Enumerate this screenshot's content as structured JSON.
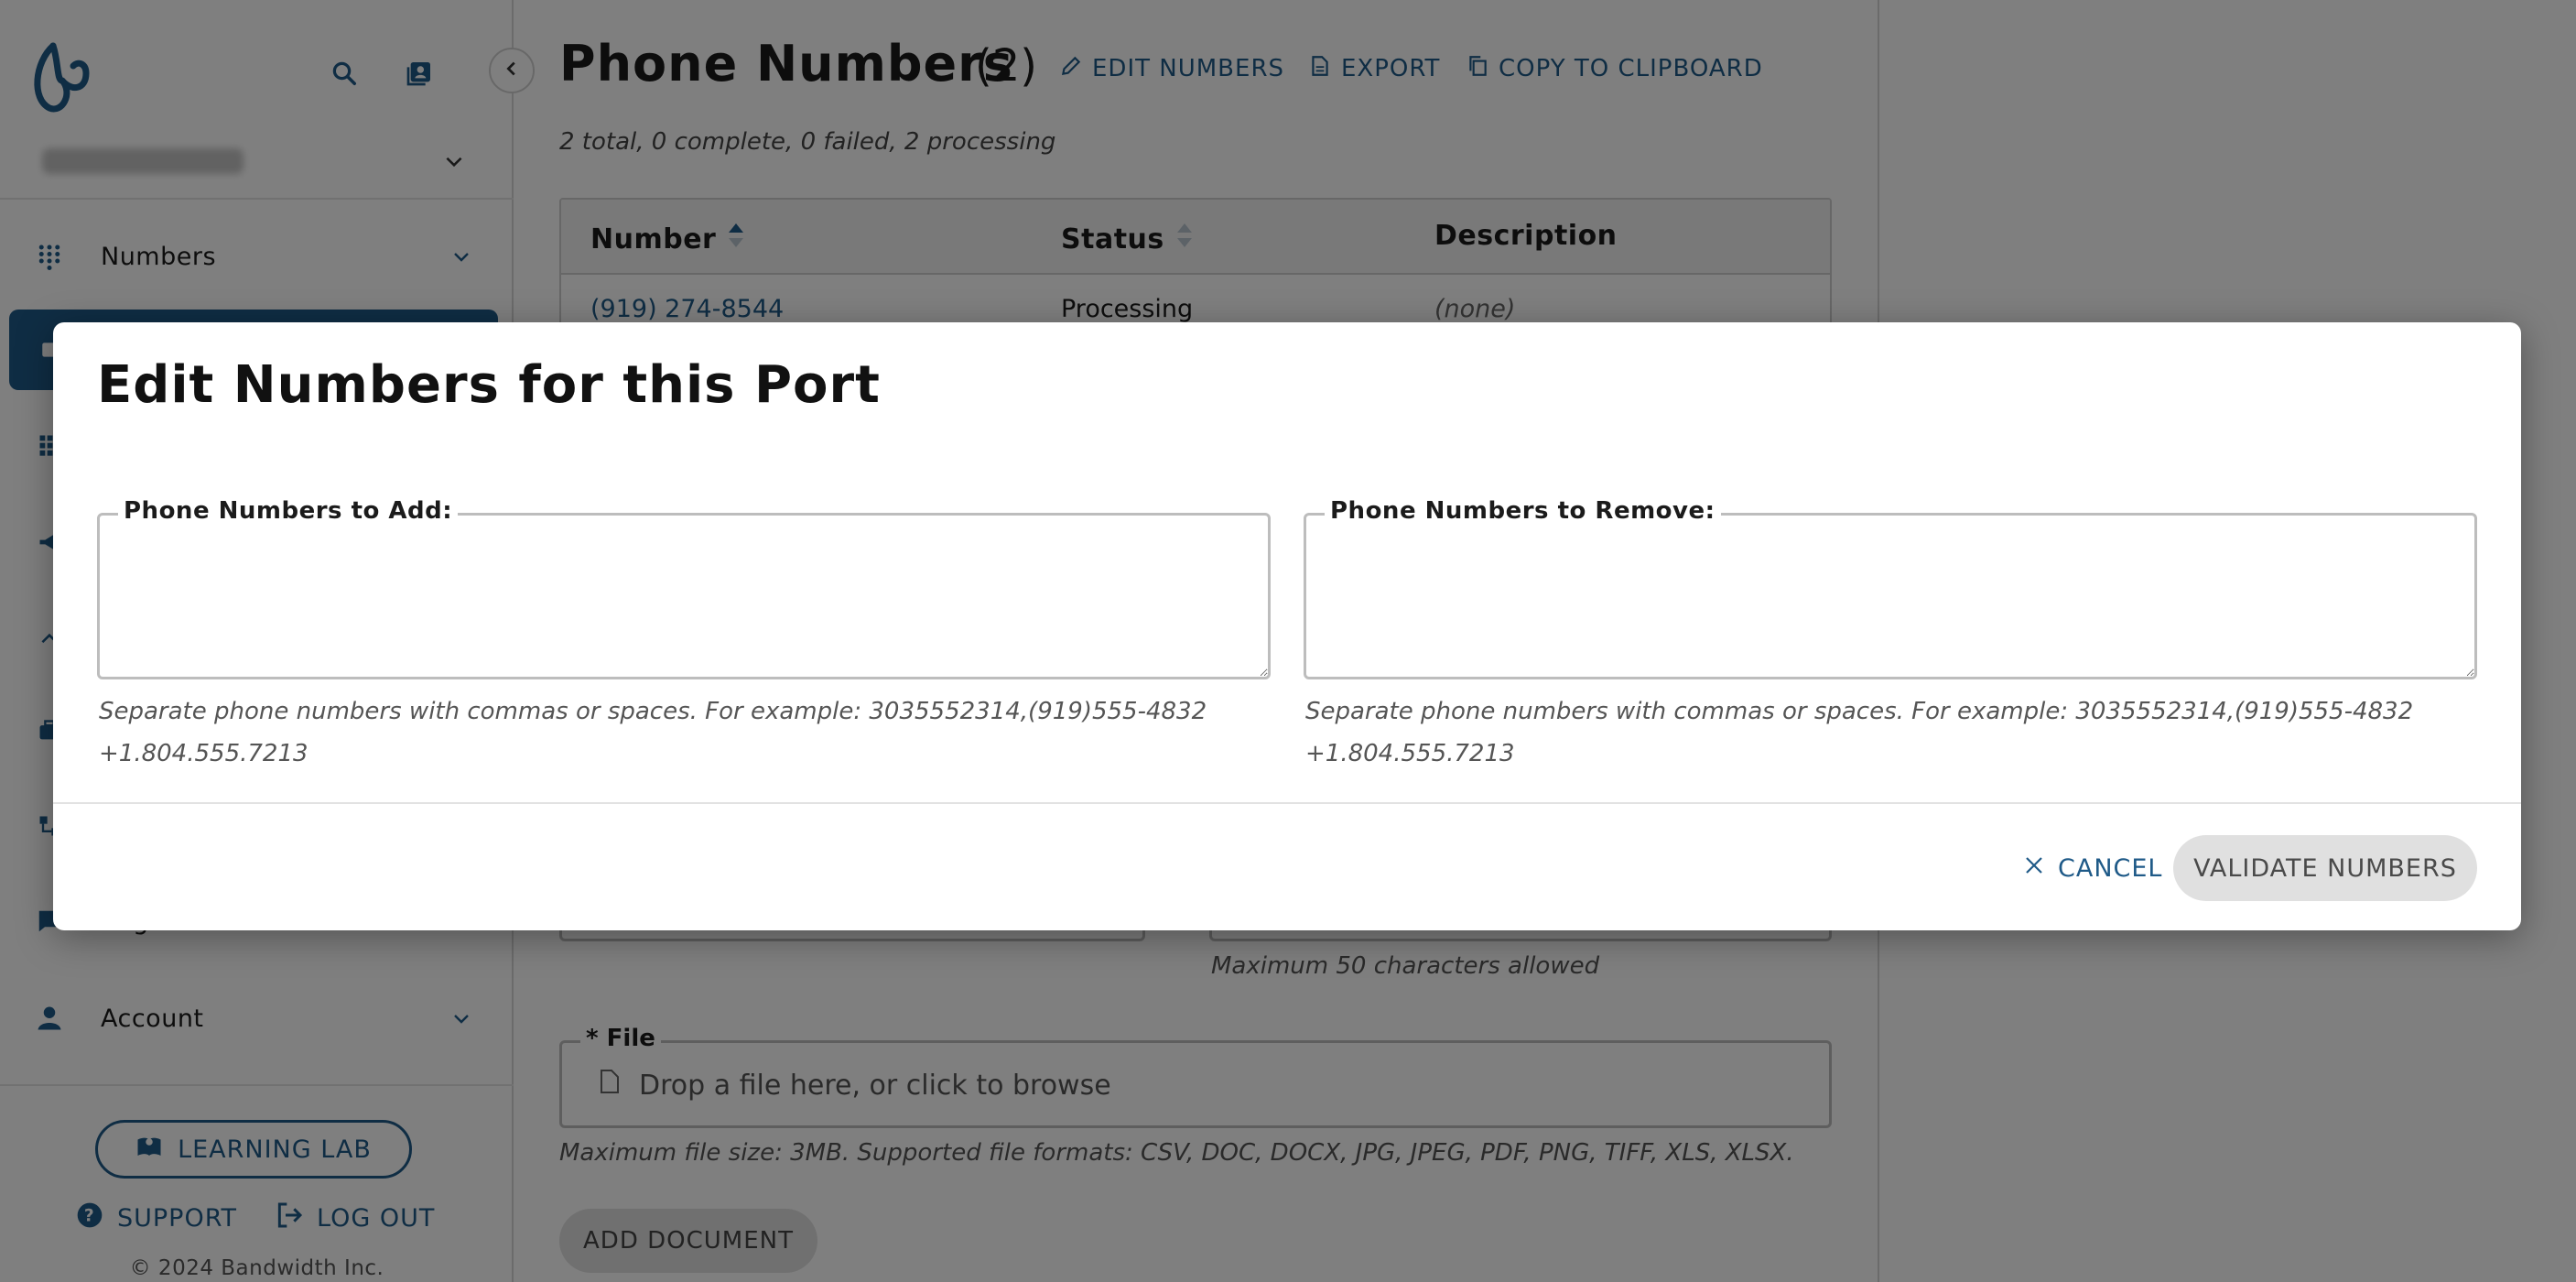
{
  "colors": {
    "brand": "#1f5a88",
    "overlay": "rgba(0,0,0,0.5)",
    "disabled_button": "#e0e0e0"
  },
  "sidebar": {
    "logo_icon": "bandwidth-logo-icon",
    "search_icon": "search-icon",
    "contacts_icon": "contacts-icon",
    "collapse_icon": "chevron-left-icon",
    "nav": [
      {
        "label": "Numbers",
        "icon": "dialpad-icon",
        "expandable": true
      },
      {
        "label": "Registration Center",
        "icon": "chat-icon"
      },
      {
        "label": "Account",
        "icon": "person-icon",
        "expandable": true
      }
    ],
    "learning_lab_label": "LEARNING LAB",
    "support_label": "SUPPORT",
    "logout_label": "LOG OUT",
    "copyright": "© 2024 Bandwidth Inc."
  },
  "main": {
    "title": "Phone Numbers",
    "count": "(2)",
    "actions": [
      {
        "label": "EDIT NUMBERS",
        "icon": "pencil-icon"
      },
      {
        "label": "EXPORT",
        "icon": "file-icon"
      },
      {
        "label": "COPY TO CLIPBOARD",
        "icon": "copy-icon"
      }
    ],
    "summary": "2 total, 0 complete, 0 failed, 2 processing",
    "table": {
      "columns": [
        "Number",
        "Status",
        "Description"
      ],
      "rows": [
        {
          "number": "(919) 274-8544",
          "status": "Processing",
          "description": "(none)"
        }
      ]
    },
    "char_hint": "Maximum 50 characters allowed",
    "file_label": "* File",
    "file_placeholder": "Drop a file here, or click to browse",
    "file_hint": "Maximum file size: 3MB. Supported file formats: CSV, DOC, DOCX, JPG, JPEG, PDF, PNG, TIFF, XLS, XLSX.",
    "add_document_label": "ADD DOCUMENT"
  },
  "modal": {
    "title": "Edit Numbers for this Port",
    "add_label": "Phone Numbers to Add:",
    "add_value": "",
    "add_hint": "Separate phone numbers with commas or spaces. For example: 3035552314,(919)555-4832 +1.804.555.7213",
    "remove_label": "Phone Numbers to Remove:",
    "remove_value": "",
    "remove_hint": "Separate phone numbers with commas or spaces. For example: 3035552314,(919)555-4832 +1.804.555.7213",
    "cancel_label": "CANCEL",
    "validate_label": "VALIDATE NUMBERS"
  }
}
